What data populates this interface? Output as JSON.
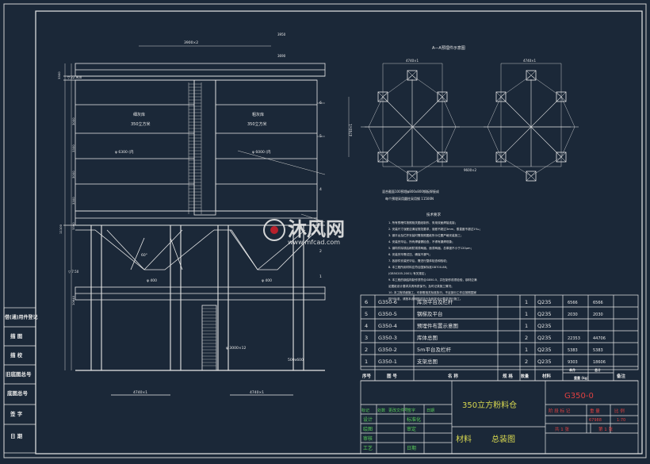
{
  "drawing": {
    "top_dims": [
      "3900×2",
      "3950",
      "3690"
    ],
    "left_dims": [
      "3300",
      "3000",
      "3300",
      "3000",
      "3300",
      "3300",
      "11100",
      "10640"
    ],
    "silo_labels": [
      "细灰库",
      "350立方米",
      "粗灰库",
      "350立方米"
    ],
    "silo_dia": [
      "φ 6300 (内",
      "φ 6000 (内"
    ],
    "dim_400": [
      "φ 400",
      "φ 400"
    ],
    "bottom_dims": [
      "4740×1",
      "4740×1",
      "500x600",
      "φ 3000×12"
    ],
    "angle_label": "60°",
    "level_labels": [
      "▽ 22.900",
      "▽ 7.50"
    ],
    "callouts": [
      "1",
      "2",
      "3",
      "4",
      "5",
      "6"
    ]
  },
  "embed_plan": {
    "title": "A—A预埋件示意图",
    "dim_top_left": "4740×1",
    "dim_top_right": "4740×1",
    "dim_side": "4740×1",
    "dim_bottom": "9600×2",
    "note1": "混合截面100预埋φ800x800钢板焊接成",
    "note2": "每个预埋采用圆柱采用钢 11500N"
  },
  "tech_notes": {
    "title": "技术要求",
    "lines": [
      "1. 所有预埋件按照相关图纸制作、采用双面焊接连接；",
      "2. 安装尺寸误差应满足规范要求，误差不超过3mm，垂直度不超过1‰；",
      "3. 钢平台及栏杆安装时需按照图纸所示位置严格安装施工；",
      "4. 安装完毕后，所有焊缝需检查，不得有漏焊现象；",
      "5. 钢构件除锈后刷防锈漆两遍，面漆两遍，总厚度不小于120μm；",
      "6. 安装完毕需试压，确保不漏气；",
      "7. 各部件安装完毕后，需进行整体检查和验收；",
      "8. 本工程所用材料应符合国家标准GB700-88；",
      "   (GB50205-2001) 有关规定；",
      "9. 本工程的钢结构制作须符合GB50-5，并在制作前须检验，钢材应满",
      "   足图纸设计要求并具有质保书；及时记录施工情况；",
      "10. 本工程详细施工，可参照相关标准执行，不足部分工作应按照国家",
      "    现行标准，请按本说明规定执行及相关设计要求进行施工。"
    ]
  },
  "watermark": {
    "text": "沐风网",
    "url": "www.mfcad.com"
  },
  "bom": {
    "rows": [
      {
        "seq": "6",
        "code": "G350-6",
        "name": "库顶平台及栏杆",
        "qty": "1",
        "mat": "Q235",
        "w1": "6566",
        "w2": "6566"
      },
      {
        "seq": "5",
        "code": "G350-5",
        "name": "钢梯及平台",
        "qty": "1",
        "mat": "Q235",
        "w1": "2030",
        "w2": "2030"
      },
      {
        "seq": "4",
        "code": "G350-4",
        "name": "预埋件布置示意图",
        "qty": "1",
        "mat": "Q235",
        "w1": "",
        "w2": ""
      },
      {
        "seq": "3",
        "code": "G350-3",
        "name": "库体总图",
        "qty": "2",
        "mat": "Q235",
        "w1": "22353",
        "w2": "44706"
      },
      {
        "seq": "2",
        "code": "G350-2",
        "name": "5m平台及栏杆",
        "qty": "1",
        "mat": "Q235",
        "w1": "5383",
        "w2": "5383"
      },
      {
        "seq": "1",
        "code": "G350-1",
        "name": "支架总图",
        "qty": "2",
        "mat": "Q235",
        "w1": "9303",
        "w2": "18606"
      }
    ],
    "headers": {
      "seq": "序号",
      "code": "图 号",
      "name": "名  称",
      "spec": "规 格",
      "qty": "数量",
      "mat": "材料",
      "w1": "单件",
      "w2": "总计",
      "weight": "重量 (kg)",
      "note": "备注"
    }
  },
  "side_table": [
    "借(通)用件登记",
    "描  图",
    "描  校",
    "旧底图总号",
    "底图总号",
    "签  字",
    "日  期"
  ],
  "title_block": {
    "title": "350立方粉料仓",
    "drawing_no": "G350-0",
    "material_label": "材料",
    "drawing_name": "总装图",
    "stage_label": "阶 段 标 记",
    "weight_label": "重 量",
    "scale_label": "比 例",
    "weight_value": "67988",
    "scale_value": "1:70",
    "sheet": "共 1 张",
    "sheet2": "第 1 张",
    "sign_rows": [
      [
        "标记",
        "处数",
        "更改文件号",
        "签字",
        "日期"
      ],
      [
        "设计",
        "",
        "标准化",
        ""
      ],
      [
        "绘图",
        "",
        "审定",
        ""
      ],
      [
        "审核",
        "",
        "",
        ""
      ],
      [
        "工艺",
        "",
        "日期",
        ""
      ]
    ]
  }
}
